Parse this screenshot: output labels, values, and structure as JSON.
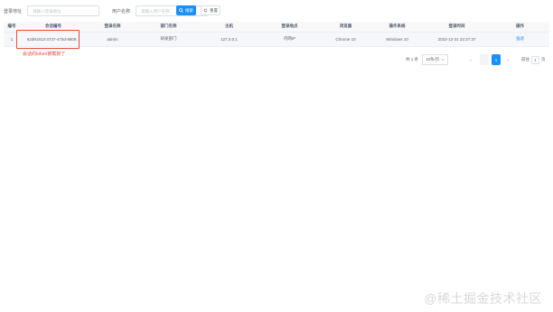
{
  "search": {
    "login_address_label": "登录地址",
    "login_address_placeholder": "请输入登录地址",
    "username_label": "用户名称",
    "username_placeholder": "请输入用户名称",
    "search_label": "搜索",
    "reset_label": "重置"
  },
  "table": {
    "columns": [
      "编号",
      "会话编号",
      "登录名称",
      "部门名称",
      "主机",
      "登录地点",
      "浏览器",
      "操作系统",
      "登录时间",
      "操作"
    ],
    "rows": [
      {
        "index": "1",
        "session_id": "62d91913-3737-470d-9808...",
        "login_name": "admin",
        "dept": "研发部门",
        "host": "127.0.0.1",
        "location": "内网IP",
        "browser": "Chrome 10",
        "os": "Windows 10",
        "login_time": "2022-12-31 22:37:37",
        "action": "强退"
      }
    ]
  },
  "annotation": "会话的token被截掉了",
  "pagination": {
    "total": "共 1 条",
    "page_size": "10条/页",
    "prev": "‹",
    "next": "›",
    "pages": [
      "1"
    ],
    "current_page": "1",
    "goto_label": "前往",
    "goto_value": "1",
    "goto_suffix": "页"
  },
  "watermark": "@稀土掘金技术社区",
  "colors": {
    "primary": "#1890ff",
    "annotation": "#e74c3c"
  }
}
